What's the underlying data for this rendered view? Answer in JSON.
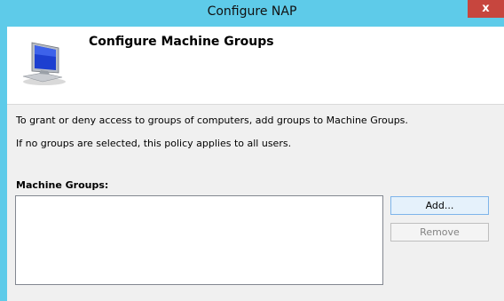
{
  "window": {
    "title": "Configure NAP",
    "close_glyph": "x"
  },
  "header": {
    "icon": "computer-monitor-icon",
    "title": "Configure Machine Groups"
  },
  "body": {
    "description_line1": "To grant or deny access to groups of computers, add groups to Machine Groups.",
    "description_line2": "If no groups are selected, this policy applies to all users.",
    "machine_groups_label": "Machine Groups:",
    "machine_groups_items": []
  },
  "buttons": {
    "add_label": "Add...",
    "remove_label": "Remove",
    "remove_enabled": false
  },
  "colors": {
    "titlebar": "#5ecbe9",
    "close_button": "#c7463e",
    "client_background": "#f0f0f0"
  }
}
